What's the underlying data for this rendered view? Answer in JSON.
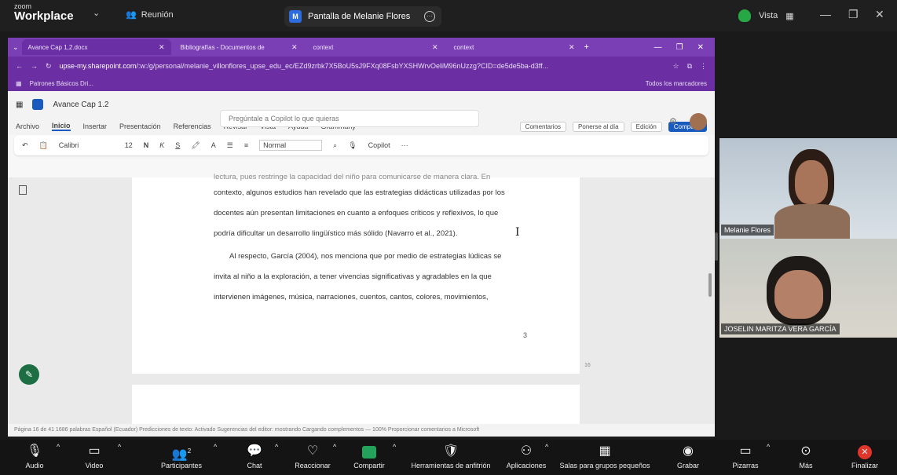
{
  "zoom": {
    "brand_small": "zoom",
    "brand": "Workplace",
    "meeting_label": "Reunión",
    "share_badge": "M",
    "share_title": "Pantalla de Melanie Flores",
    "view_label": "Vista"
  },
  "browser": {
    "tabs": [
      {
        "label": "Avance Cap 1,2.docx"
      },
      {
        "label": "Bibliografías - Documentos de"
      },
      {
        "label": "context"
      },
      {
        "label": "context"
      }
    ],
    "url_host": "upse-my.sharepoint.com",
    "url_rest": "/:w:/g/personal/melanie_villonflores_upse_edu_ec/EZd9zrbk7X5BoU5sJ9FXq08FsbYXSHWrvOeliM96nUzzg?CID=de5de5ba-d3ff...",
    "bookmark": "Patrones Básicos Dri...",
    "all_bookmarks": "Todos los marcadores"
  },
  "word": {
    "doc_name": "Avance Cap 1.2",
    "copilot_placeholder": "Pregúntale a Copilot lo que quieras",
    "menu": [
      "Archivo",
      "Inicio",
      "Insertar",
      "Presentación",
      "Referencias",
      "Revisar",
      "Vista",
      "Ayuda",
      "Grammarly"
    ],
    "comments_btn": "Comentarios",
    "catchup_btn": "Ponerse al día",
    "editing_btn": "Edición",
    "share_btn": "Compartir",
    "font": "Calibri",
    "size": "12",
    "style": "Normal",
    "copilot": "Copilot",
    "paragraphs": [
      "lectura, pues restringe la capacidad del niño para comunicarse de manera clara. En",
      "contexto, algunos estudios han revelado que las estrategias didácticas utilizadas por los",
      "docentes aún presentan limitaciones en cuanto a enfoques críticos y reflexivos, lo que",
      "podría dificultar un desarrollo lingüístico más sólido (Navarro et al., 2021).",
      "Al respecto, García (2004), nos menciona que por medio de estrategias lúdicas se",
      "invita al niño a la exploración, a tener vivencias significativas y agradables en la que",
      "intervienen imágenes, música, narraciones, cuentos, cantos, colores, movimientos,"
    ],
    "page_number": "3",
    "side_page_num": "16",
    "status": "Página 16 de 41   1686 palabras   Español (Ecuador)   Predicciones de texto: Activado   Sugerencias del editor: mostrando   Cargando complementos   —   100%   Proporcionar comentarios a Microsoft"
  },
  "participants": [
    {
      "name": "Melanie Flores"
    },
    {
      "name": "JOSELIN MARITZA VERA GARCÍA"
    }
  ],
  "toolbar": {
    "audio": "Audio",
    "video": "Video",
    "participants": "Participantes",
    "participants_count": "2",
    "chat": "Chat",
    "react": "Reaccionar",
    "share": "Compartir",
    "host_tools": "Herramientas de anfitrión",
    "apps": "Aplicaciones",
    "breakout": "Salas para grupos pequeños",
    "record": "Grabar",
    "whiteboards": "Pizarras",
    "more": "Más",
    "end": "Finalizar"
  },
  "colors": {
    "browser_accent": "#7b3fb5",
    "word_blue": "#185abd",
    "share_green": "#23a35a",
    "end_red": "#e0352b"
  }
}
